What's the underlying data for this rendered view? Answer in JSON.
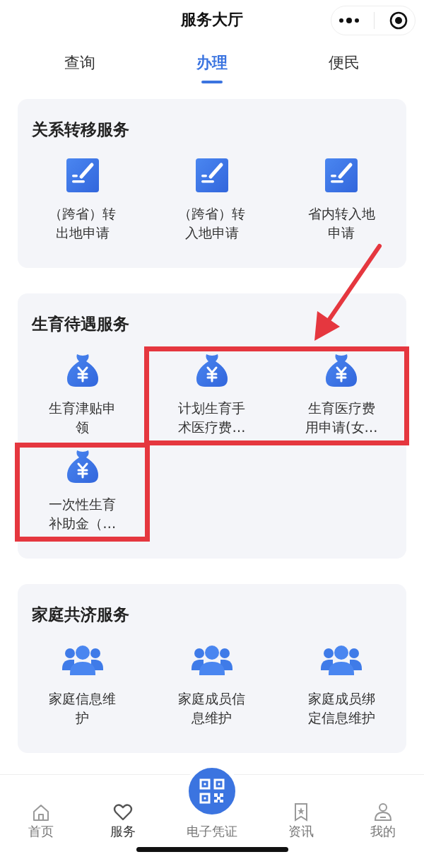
{
  "nav": {
    "title": "服务大厅"
  },
  "tabs": [
    {
      "label": "查询",
      "selected": false
    },
    {
      "label": "办理",
      "selected": true
    },
    {
      "label": "便民",
      "selected": false
    }
  ],
  "sections": [
    {
      "title": "关系转移服务",
      "arrow": false,
      "items": [
        {
          "kind": "form",
          "label": "（跨省）转出地申请",
          "highlighted": false
        },
        {
          "kind": "form",
          "label": "（跨省）转入地申请",
          "highlighted": false
        },
        {
          "kind": "form",
          "label": "省内转入地申请",
          "highlighted": false
        }
      ]
    },
    {
      "title": "生育待遇服务",
      "arrow": true,
      "items": [
        {
          "kind": "moneybag",
          "label": "生育津贴申领",
          "highlighted": false
        },
        {
          "kind": "moneybag",
          "label": "计划生育手术医疗费…",
          "highlighted": true
        },
        {
          "kind": "moneybag",
          "label": "生育医疗费用申请(女…",
          "highlighted": true
        },
        {
          "kind": "moneybag",
          "label": "一次性生育补助金（…",
          "highlighted": true
        }
      ]
    },
    {
      "title": "家庭共济服务",
      "arrow": false,
      "items": [
        {
          "kind": "people",
          "label": "家庭信息维护",
          "highlighted": false
        },
        {
          "kind": "people",
          "label": "家庭成员信息维护",
          "highlighted": false
        },
        {
          "kind": "people",
          "label": "家庭成员绑定信息维护",
          "highlighted": false
        }
      ]
    }
  ],
  "tab_bar": {
    "items": [
      {
        "kind": "tab",
        "label": "首页",
        "selected": false
      },
      {
        "kind": "tab",
        "label": "服务",
        "selected": true
      },
      {
        "kind": "raised",
        "label": "电子凭证",
        "selected": false
      },
      {
        "kind": "tab",
        "label": "资讯",
        "selected": false
      },
      {
        "kind": "tab",
        "label": "我的",
        "selected": false
      }
    ]
  }
}
